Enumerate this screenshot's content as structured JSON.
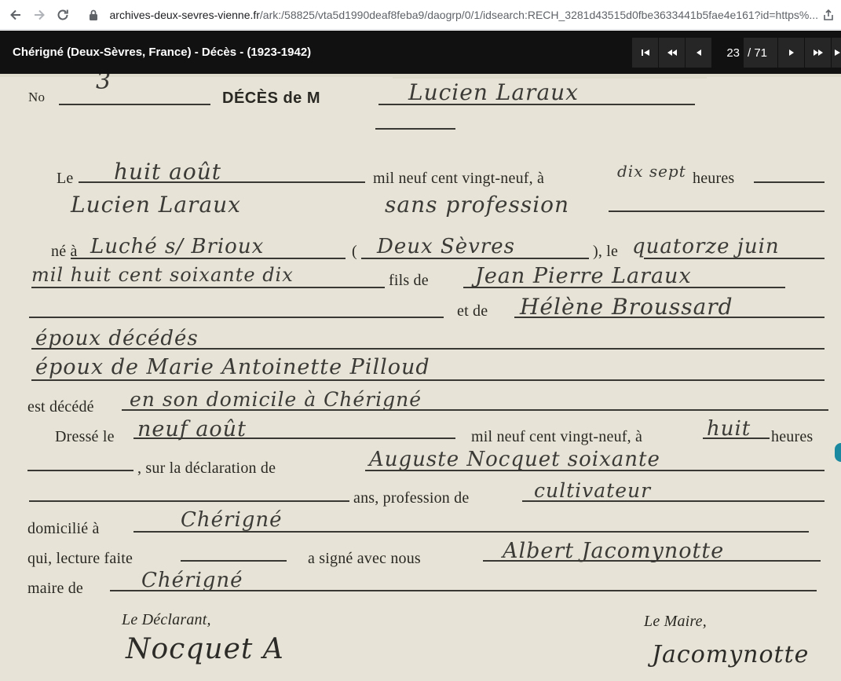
{
  "browser": {
    "url_host": "archives-deux-sevres-vienne.fr",
    "url_path": "/ark:/58825/vta5d1990deaf8feba9/daogrp/0/1/idsearch:RECH_3281d43515d0fbe3633441b5fae4e161?id=https%..."
  },
  "viewer": {
    "title": "Chérigné (Deux-Sèvres, France) - Décès - (1923-1942)",
    "current_page": "23",
    "total_pages": "/ 71"
  },
  "document": {
    "printed": {
      "no": "No",
      "header": "DÉCÈS de M",
      "le": "Le",
      "mil": "mil neuf cent vingt-neuf, à",
      "heures": "heures",
      "nea": "né à",
      "paren_open": "(",
      "paren_close": "), le",
      "fils_de": "fils de",
      "et_de": "et de",
      "est_decede": "est décédé",
      "dresse": "Dressé le",
      "mil2": "mil neuf cent vingt-neuf, à",
      "heures2": "heures",
      "sur_decl": ", sur la déclaration de",
      "ans_prof": "ans, profession de",
      "domicilie": "domicilié à",
      "qui_lecture": "qui, lecture faite",
      "signe_avec": "a signé avec nous",
      "maire_de": "maire de",
      "le_declarant": "Le Déclarant,",
      "le_maire": "Le Maire,"
    },
    "handwritten": {
      "number": "3",
      "name_header": "Lucien Laraux",
      "date_death": "huit août",
      "hour_death": "dix sept",
      "name_full": "Lucien Laraux",
      "profession": "sans profession",
      "birthplace": "Luché s/ Brioux",
      "department": "Deux Sèvres",
      "birth_day": "quatorze juin",
      "birth_year": "mil huit cent soixante dix",
      "father": "Jean Pierre Laraux",
      "mother": "Hélène Broussard",
      "parents_status": "époux décédés",
      "spouse": "époux de Marie Antoinette Pilloud",
      "death_place": "en son domicile à Chérigné",
      "date_record": "neuf août",
      "hour_record": "huit",
      "declarant": "Auguste Nocquet soixante",
      "declarant_prof": "cultivateur",
      "declarant_home": "Chérigné",
      "mayor": "Albert Jacomynotte",
      "commune": "Chérigné",
      "sig_declarant": "Nocquet A",
      "sig_maire": "Jacomynotte"
    }
  }
}
